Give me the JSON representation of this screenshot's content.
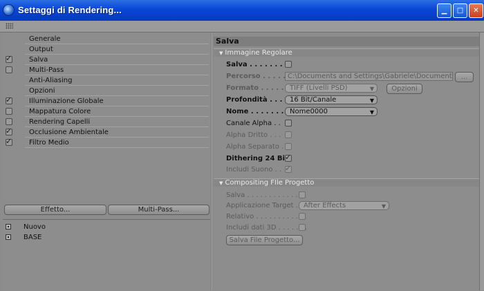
{
  "window": {
    "title": "Settaggi di Rendering..."
  },
  "nav": {
    "items": [
      {
        "label": "Generale",
        "checkbox": false,
        "checked": false
      },
      {
        "label": "Output",
        "checkbox": false,
        "checked": false
      },
      {
        "label": "Salva",
        "checkbox": true,
        "checked": true
      },
      {
        "label": "Multi-Pass",
        "checkbox": true,
        "checked": false
      },
      {
        "label": "Anti-Aliasing",
        "checkbox": false,
        "checked": false
      },
      {
        "label": "Opzioni",
        "checkbox": false,
        "checked": false
      },
      {
        "label": "Illuminazione Globale",
        "checkbox": true,
        "checked": true
      },
      {
        "label": "Mappatura Colore",
        "checkbox": true,
        "checked": false
      },
      {
        "label": "Rendering Capelli",
        "checkbox": true,
        "checked": false
      },
      {
        "label": "Occlusione Ambientale",
        "checkbox": true,
        "checked": true
      },
      {
        "label": "Filtro Medio",
        "checkbox": true,
        "checked": true
      }
    ],
    "effect_button": "Effetto...",
    "multipass_button": "Multi-Pass..."
  },
  "presets": [
    "Nuovo",
    "BASE"
  ],
  "panel": {
    "section_title": "Salva",
    "image_group": {
      "title": "Immagine Regolare",
      "salva_label": "Salva . . . . . . . .",
      "salva_checked": false,
      "percorso_label": "Percorso . . . . . .",
      "percorso_value": "C:\\Documents and Settings\\Gabriele\\Documenti\\MOD",
      "browse_button": "...",
      "formato_label": "Formato . . . . . .",
      "formato_value": "TIFF (Livelli PSD)",
      "opzioni_button": "Opzioni",
      "profondita_label": "Profondità . . . .",
      "profondita_value": "16 Bit/Canale",
      "nome_label": "Nome . . . . . . . .",
      "nome_value": "Nome0000",
      "alpha_label": "Canale Alpha . .",
      "alpha_checked": false,
      "alpha_dritto_label": "Alpha Dritto . . .",
      "alpha_dritto_checked": false,
      "alpha_separato_label": "Alpha Separato . .",
      "alpha_separato_checked": false,
      "dithering_label": "Dithering 24 Bit",
      "dithering_checked": true,
      "suono_label": "Includi Suono . .",
      "suono_checked": true
    },
    "compositing_group": {
      "title": "Compositing FIle Progetto",
      "salva_label": "Salva . . . . . . . . . . . . . .",
      "salva_checked": false,
      "app_label": "Applicazione Target . . .",
      "app_value": "After Effects",
      "relativo_label": "Relativo . . . . . . . . . . . .",
      "relativo_checked": false,
      "dati3d_label": "Includi dati 3D . . . . . . .",
      "dati3d_checked": false,
      "save_button": "Salva File Progetto..."
    }
  }
}
